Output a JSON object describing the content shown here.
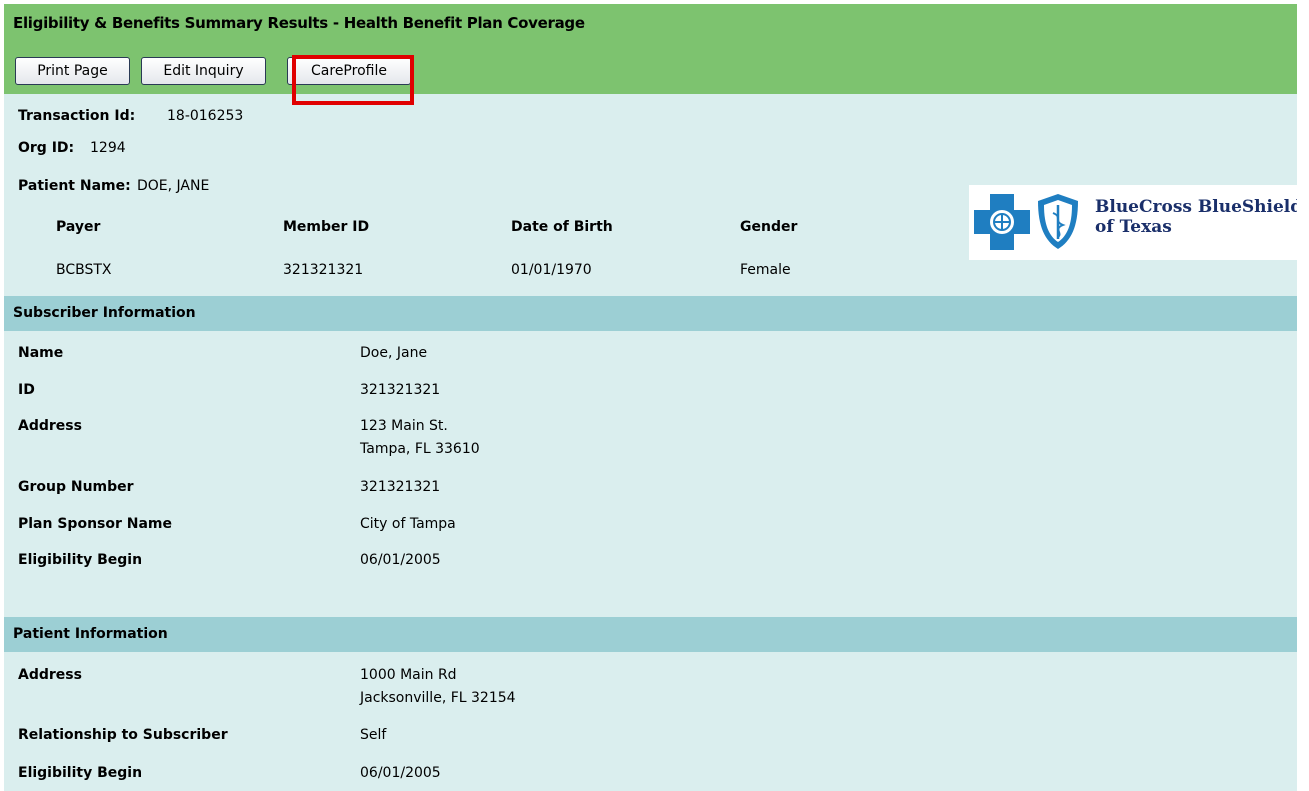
{
  "header": {
    "title": "Eligibility & Benefits Summary Results - Health Benefit Plan Coverage",
    "buttons": {
      "print": "Print Page",
      "edit": "Edit Inquiry",
      "careprofile": "CareProfile"
    }
  },
  "transaction": {
    "id_label": "Transaction Id:",
    "id_value": "18-016253",
    "org_label": "Org ID:",
    "org_value": "1294",
    "patient_label": "Patient Name:",
    "patient_value": "DOE, JANE"
  },
  "member_table": {
    "headers": {
      "payer": "Payer",
      "member_id": "Member ID",
      "dob": "Date of Birth",
      "gender": "Gender"
    },
    "row": {
      "payer": "BCBSTX",
      "member_id": "321321321",
      "dob": "01/01/1970",
      "gender": "Female"
    }
  },
  "logo": {
    "line1": "BlueCross BlueShield",
    "line2": "of Texas"
  },
  "subscriber": {
    "section_title": "Subscriber Information",
    "name_label": "Name",
    "name_value": "Doe, Jane",
    "id_label": "ID",
    "id_value": "321321321",
    "address_label": "Address",
    "address_line1": "123 Main St.",
    "address_line2": "Tampa, FL 33610",
    "group_label": "Group Number",
    "group_value": "321321321",
    "sponsor_label": "Plan Sponsor Name",
    "sponsor_value": "City of Tampa",
    "elig_label": "Eligibility Begin",
    "elig_value": "06/01/2005"
  },
  "patient": {
    "section_title": "Patient Information",
    "address_label": "Address",
    "address_line1": "1000 Main Rd",
    "address_line2": "Jacksonville, FL 32154",
    "relationship_label": "Relationship to Subscriber",
    "relationship_value": "Self",
    "elig_label": "Eligibility Begin",
    "elig_value": "06/01/2005"
  },
  "colors": {
    "header_green": "#7dc36f",
    "section_blue": "#9ccfd4",
    "panel": "#daeeee",
    "highlight_red": "#e00000",
    "logo_navy": "#1a2f6a"
  }
}
